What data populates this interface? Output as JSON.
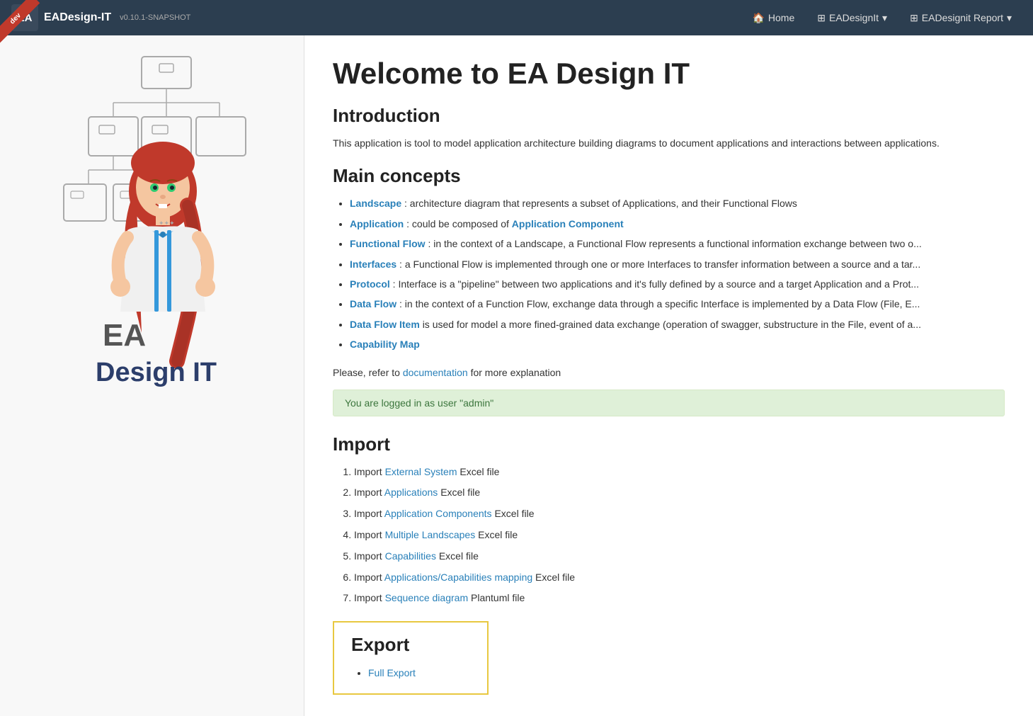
{
  "navbar": {
    "logo_text": "EA",
    "title": "EADesign-IT",
    "version": "v0.10.1-SNAPSHOT",
    "dev_badge": "dev",
    "nav_items": [
      {
        "icon": "🏠",
        "label": "Home"
      },
      {
        "icon": "⊞",
        "label": "EADesignIt",
        "has_dropdown": true
      },
      {
        "icon": "⊞",
        "label": "EADesignit Report",
        "has_dropdown": true
      }
    ]
  },
  "main": {
    "page_title": "Welcome to EA Design IT",
    "intro_heading": "Introduction",
    "intro_text": "This application is tool to model application architecture building diagrams to document applications and interactions between applications.",
    "concepts_heading": "Main concepts",
    "concepts": [
      {
        "link": "Landscape",
        "text": " : architecture diagram that represents a subset of Applications, and their Functional Flows"
      },
      {
        "link": "Application",
        "text": " : could be composed of ",
        "link2": "Application Component"
      },
      {
        "link": "Functional Flow",
        "text": " : in the context of a Landscape, a Functional Flow represents a functional information exchange between two o..."
      },
      {
        "link": "Interfaces",
        "text": " : a Functional Flow is implemented through one or more Interfaces to transfer information between a source and a tar..."
      },
      {
        "link": "Protocol",
        "text": " : Interface is a \"pipeline\" between two applications and it's fully defined by a source and a target Application and a Prot..."
      },
      {
        "link": "Data Flow",
        "text": " : in the context of a Function Flow, exchange data through a specific Interface is implemented by a Data Flow (File, E..."
      },
      {
        "link": "Data Flow Item",
        "text": " is used for model a more fined-grained data exchange (operation of swagger, substructure in the File, event of a..."
      },
      {
        "link": "Capability Map",
        "text": ""
      }
    ],
    "doc_line_prefix": "Please, refer to ",
    "doc_link": "documentation",
    "doc_line_suffix": " for more explanation",
    "alert_text": "You are logged in as user \"admin\"",
    "import_heading": "Import",
    "import_items": [
      {
        "prefix": "Import ",
        "link": "External System",
        "suffix": " Excel file"
      },
      {
        "prefix": "Import ",
        "link": "Applications",
        "suffix": " Excel file"
      },
      {
        "prefix": "Import ",
        "link": "Application Components",
        "suffix": " Excel file"
      },
      {
        "prefix": "Import ",
        "link": "Multiple Landscapes",
        "suffix": " Excel file"
      },
      {
        "prefix": "Import ",
        "link": "Capabilities",
        "suffix": " Excel file"
      },
      {
        "prefix": "Import ",
        "link": "Applications/Capabilities mapping",
        "suffix": " Excel file"
      },
      {
        "prefix": "Import ",
        "link": "Sequence diagram",
        "suffix": " Plantuml file"
      }
    ],
    "export_heading": "Export",
    "export_items": [
      {
        "link": "Full Export",
        "suffix": ""
      }
    ]
  }
}
